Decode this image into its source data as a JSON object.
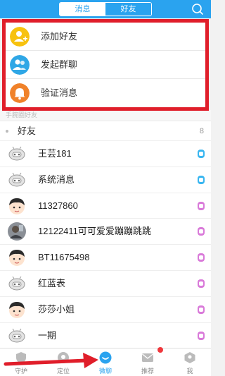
{
  "header": {
    "tabs": [
      {
        "label": "消息"
      },
      {
        "label": "好友"
      }
    ],
    "active_tab": "消息"
  },
  "popup_menu": {
    "items": [
      {
        "label": "添加好友",
        "icon": "add-friend-icon",
        "color": "#f7c20f"
      },
      {
        "label": "发起群聊",
        "icon": "group-chat-icon",
        "color": "#2fa7e6"
      },
      {
        "label": "验证消息",
        "icon": "bell-icon",
        "color": "#f0822a"
      }
    ]
  },
  "sub_section_label": "手腕圈好友",
  "friends_group": {
    "name": "好友",
    "count": "8"
  },
  "contacts": [
    {
      "name": "王芸181",
      "avatar": "robot-avatar",
      "status_color": "#39b6f0"
    },
    {
      "name": "系统消息",
      "avatar": "robot-avatar",
      "status_color": "#39b6f0"
    },
    {
      "name": "11327860",
      "avatar": "boy-avatar",
      "status_color": "#d97ad9"
    },
    {
      "name": "12122411可可爱爱蹦蹦跳跳",
      "avatar": "photo-avatar",
      "status_color": "#d97ad9"
    },
    {
      "name": "BT11675498",
      "avatar": "boy-avatar",
      "status_color": "#d97ad9"
    },
    {
      "name": "红蓝表",
      "avatar": "robot-avatar",
      "status_color": "#d97ad9"
    },
    {
      "name": "莎莎小姐",
      "avatar": "boy-avatar",
      "status_color": "#d97ad9"
    },
    {
      "name": "一期",
      "avatar": "robot-avatar",
      "status_color": "#d97ad9"
    }
  ],
  "tabbar": {
    "items": [
      {
        "label": "守护",
        "icon": "shield-icon"
      },
      {
        "label": "定位",
        "icon": "location-icon"
      },
      {
        "label": "微聊",
        "icon": "chat-bubble-icon"
      },
      {
        "label": "推荐",
        "icon": "mail-icon"
      },
      {
        "label": "我",
        "icon": "profile-icon"
      }
    ],
    "active": "微聊"
  },
  "colors": {
    "brand": "#2aa3ef",
    "highlight_border": "#e01e2a",
    "arrow": "#e01e2a",
    "badge": "#f0373c"
  }
}
